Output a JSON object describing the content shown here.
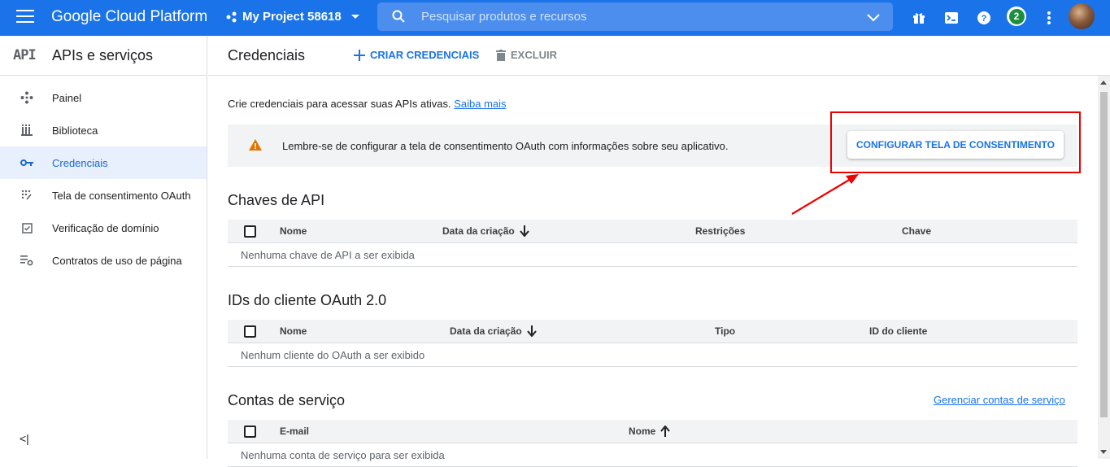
{
  "topbar": {
    "brand": "Google Cloud Platform",
    "project": "My Project 58618",
    "search_placeholder": "Pesquisar produtos e recursos",
    "notification_count": "2",
    "bg_color": "#1a73e8"
  },
  "sidebar": {
    "logo": "API",
    "title": "APIs e serviços",
    "items": [
      {
        "label": "Painel",
        "icon": "dashboard-icon"
      },
      {
        "label": "Biblioteca",
        "icon": "library-icon"
      },
      {
        "label": "Credenciais",
        "icon": "key-icon",
        "active": true
      },
      {
        "label": "Tela de consentimento OAuth",
        "icon": "consent-icon"
      },
      {
        "label": "Verificação de domínio",
        "icon": "checkbox-icon"
      },
      {
        "label": "Contratos de uso de página",
        "icon": "settings-list-icon"
      }
    ],
    "collapse": "<|"
  },
  "page": {
    "title": "Credenciais",
    "create_label": "CRIAR CREDENCIAIS",
    "delete_label": "EXCLUIR",
    "intro_text": "Crie credenciais para acessar suas APIs ativas.",
    "intro_link": "Saiba mais",
    "warning_text": "Lembre-se de configurar a tela de consentimento OAuth com informações sobre seu aplicativo.",
    "configure_button": "CONFIGURAR TELA DE CONSENTIMENTO"
  },
  "api_keys": {
    "title": "Chaves de API",
    "columns": [
      "Nome",
      "Data da criação",
      "Restrições",
      "Chave"
    ],
    "empty": "Nenhuma chave de API a ser exibida"
  },
  "oauth_clients": {
    "title": "IDs do cliente OAuth 2.0",
    "columns": [
      "Nome",
      "Data da criação",
      "Tipo",
      "ID do cliente"
    ],
    "empty": "Nenhum cliente do OAuth a ser exibido"
  },
  "service_accounts": {
    "title": "Contas de serviço",
    "manage_link": "Gerenciar contas de serviço",
    "columns": [
      "E-mail",
      "Nome"
    ],
    "empty": "Nenhuma conta de serviço para ser exibida"
  }
}
